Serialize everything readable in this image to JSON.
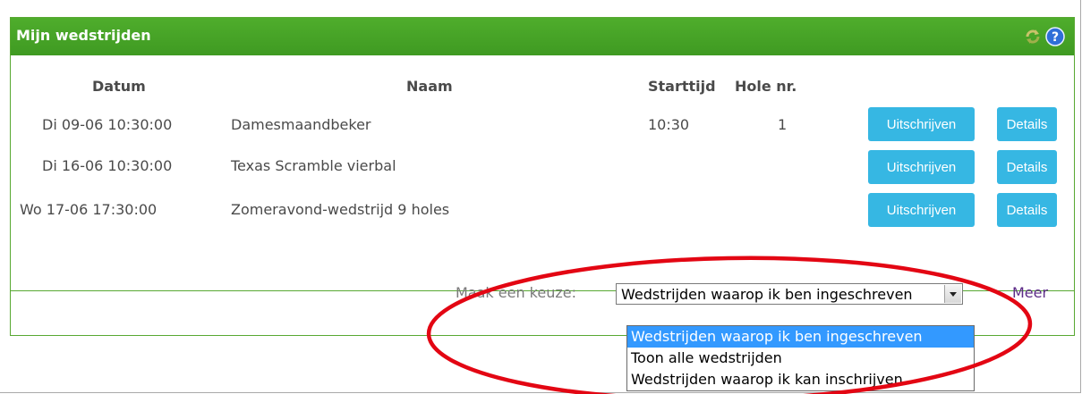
{
  "panel": {
    "title": "Mijn wedstrijden"
  },
  "table": {
    "headers": [
      "Datum",
      "Naam",
      "Starttijd",
      "Hole nr."
    ],
    "rows": [
      {
        "datum": "Di 09-06 10:30:00",
        "naam": "Damesmaandbeker",
        "starttijd": "10:30",
        "hole": "1"
      },
      {
        "datum": "Di 16-06 10:30:00",
        "naam": "Texas Scramble vierbal",
        "starttijd": "",
        "hole": ""
      },
      {
        "datum": "Wo 17-06 17:30:00",
        "naam": "Zomeravond-wedstrijd 9 holes",
        "starttijd": "",
        "hole": ""
      }
    ],
    "unsubscribe_label": "Uitschrijven",
    "details_label": "Details"
  },
  "footer": {
    "choice_label": "Maak een keuze:",
    "selected": "Wedstrijden waarop ik ben ingeschreven",
    "options": [
      "Wedstrijden waarop ik ben ingeschreven",
      "Toon alle wedstrijden",
      "Wedstrijden waarop ik kan inschrijven"
    ],
    "more_link": "Meer"
  },
  "icons": {
    "refresh": "refresh-icon",
    "help": "help-icon"
  },
  "colors": {
    "header_green": "#4fad2c",
    "button_blue": "#36b7e3",
    "annotation_red": "#e30613",
    "option_highlight": "#3399ff"
  }
}
